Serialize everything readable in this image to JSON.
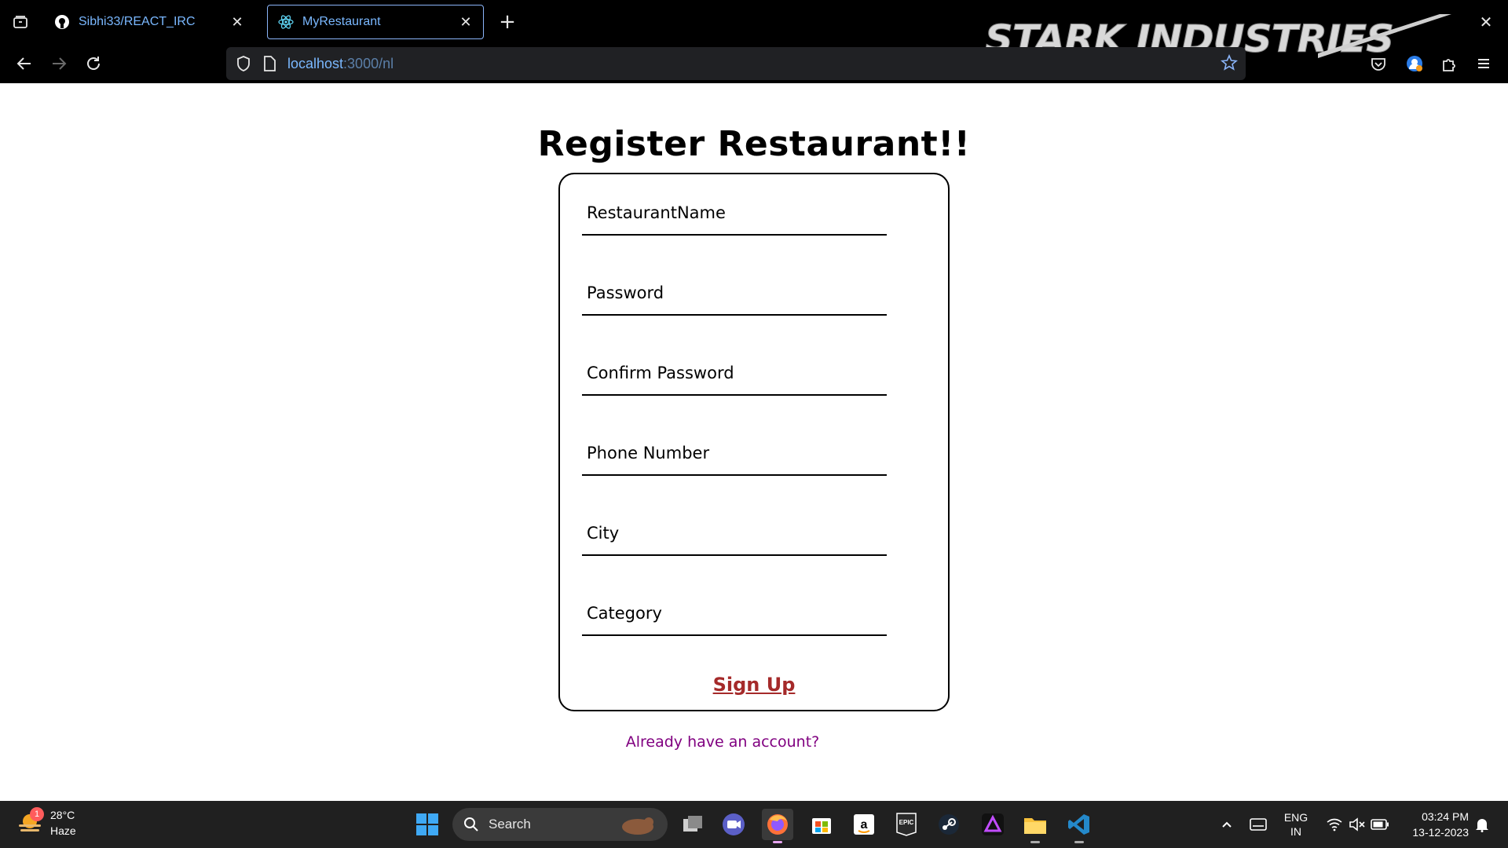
{
  "browser": {
    "tabs": [
      {
        "title": "Sibhi33/REACT_IRC",
        "favicon": "github-icon",
        "active": false
      },
      {
        "title": "MyRestaurant",
        "favicon": "react-icon",
        "active": true
      }
    ],
    "url_host": "localhost",
    "url_path": ":3000/nl",
    "theme_logo": "STARK INDUSTRIES"
  },
  "page": {
    "title": "Register Restaurant!!",
    "fields": [
      {
        "placeholder": "RestaurantName",
        "value": ""
      },
      {
        "placeholder": "Password",
        "value": ""
      },
      {
        "placeholder": "Confirm Password",
        "value": ""
      },
      {
        "placeholder": "Phone Number",
        "value": ""
      },
      {
        "placeholder": "City",
        "value": ""
      },
      {
        "placeholder": "Category",
        "value": ""
      }
    ],
    "submit_label": "Sign Up",
    "login_link": "Already have an account?"
  },
  "taskbar": {
    "weather_temp": "28°C",
    "weather_desc": "Haze",
    "weather_badge": "1",
    "search_label": "Search",
    "lang_top": "ENG",
    "lang_bottom": "IN",
    "time": "03:24 PM",
    "date": "13-12-2023"
  },
  "colors": {
    "signup": "#a52a2a",
    "login_link": "#800080",
    "tab_text": "#7ab8ff"
  }
}
